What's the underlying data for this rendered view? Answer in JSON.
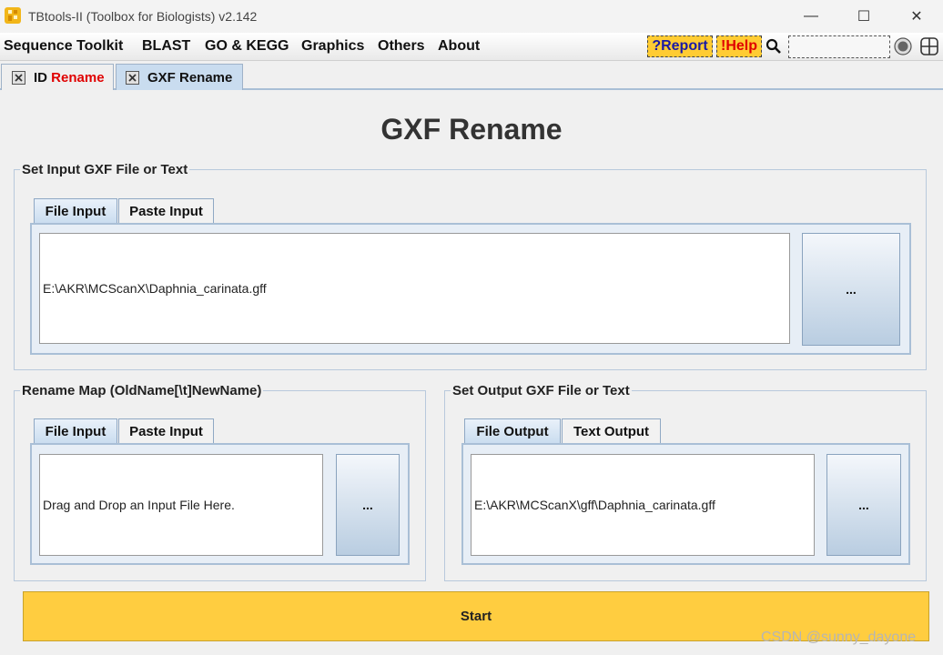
{
  "window": {
    "title": "TBtools-II (Toolbox for Biologists) v2.142",
    "minimize": "—",
    "maximize": "☐",
    "close": "✕"
  },
  "menu": {
    "items": [
      "Sequence Toolkit",
      "BLAST",
      "GO & KEGG",
      "Graphics",
      "Others",
      "About"
    ],
    "report": "?Report",
    "help": "!Help"
  },
  "doc_tabs": {
    "tab1_prefix": "ID ",
    "tab1_suffix": "Rename",
    "tab2": "GXF Rename"
  },
  "page": {
    "title": "GXF Rename"
  },
  "input_group": {
    "label": "Set Input GXF File or Text",
    "tab_file": "File Input",
    "tab_paste": "Paste Input",
    "value": "E:\\AKR\\MCScanX\\Daphnia_carinata.gff",
    "browse": "..."
  },
  "map_group": {
    "label": "Rename Map (OldName[\\t]NewName)",
    "tab_file": "File Input",
    "tab_paste": "Paste Input",
    "value": "Drag and Drop an Input File Here.",
    "browse": "..."
  },
  "output_group": {
    "label": "Set Output GXF File or Text",
    "tab_file": "File Output",
    "tab_text": "Text Output",
    "value": "E:\\AKR\\MCScanX\\gff\\Daphnia_carinata.gff",
    "browse": "..."
  },
  "start_label": "Start",
  "watermark": "CSDN @sunny_dayone",
  "colors": {
    "accent_yellow": "#ffcd40",
    "tab_active": "#c9dcef",
    "report_text": "#1a1aa6",
    "help_text": "#e00000"
  }
}
